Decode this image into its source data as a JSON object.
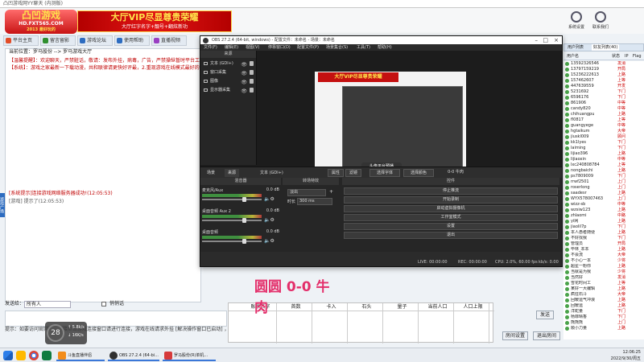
{
  "chat_app": {
    "window_title": "凸凹游戏网YY聊天 (内测版)",
    "logo": {
      "line1": "凸凹游戏",
      "line2": "HD.FXT565.COM",
      "line3": "2013 最好玩的"
    },
    "vip_banner": {
      "title": "大厅VIP尽显尊贵荣耀",
      "subtitle": "大厅红字名字+靓号+翻炫新功"
    },
    "tabs": [
      {
        "label": "平台主页",
        "color": "#e34c26"
      },
      {
        "label": "留言留影",
        "color": "#2f8f2f"
      },
      {
        "label": "游戏论坛",
        "color": "#2d6cc0"
      },
      {
        "label": "使用帮助",
        "color": "#2d6cc0"
      },
      {
        "label": "直播视频",
        "color": "#9a3fc2"
      }
    ],
    "breadcrumb": "当前位置：罗马股份 --> 罗马游戏大厅",
    "messages": [
      {
        "text": "【温馨提醒】：欢迎聊天，严禁脏话，敬请：发布外挂，病毒，广告，严禁操纵暂时平台工作人员",
        "color": "#c00000"
      },
      {
        "text": "【系统】：游戏之家最新一下载动漫，共和联律请更快好评最，2.重现游戏在线模式最好的进行游戏，回顾游戏",
        "color": "#c00000"
      },
      {
        "text": "[系统提示]连接游戏网络服务器成功!(12:05:53)",
        "color": "#c00000"
      },
      {
        "text": "[游戏] 提示了(12:05:53)",
        "color": "#555555"
      }
    ],
    "side_tag": "游戏广场",
    "send_label": "发送给：",
    "send_target": "所有人",
    "private_label": "悄悄话",
    "bottom_hint": "提示：如要访问官网，请直接点击游戏连接窗口请进行连接，游戏在线请求外挂 [解决操作窗口已启动]  ，这个文件",
    "tools": [
      {
        "label": "系统设置"
      },
      {
        "label": "联系我们"
      }
    ],
    "user_panel_tabs": [
      "用户列表",
      "好友列表(40)"
    ],
    "user_columns": [
      "用户名",
      "状态",
      "IP",
      "Flag"
    ],
    "users": [
      {
        "name": "13592326546",
        "status": "发消"
      },
      {
        "name": "13797159219",
        "status": "开局"
      },
      {
        "name": "15236222613",
        "status": "上路"
      },
      {
        "name": "157462607",
        "status": "上等"
      },
      {
        "name": "447639559",
        "status": "开发"
      },
      {
        "name": "5231692",
        "status": "下门"
      },
      {
        "name": "6596176",
        "status": "下门"
      },
      {
        "name": "861906",
        "status": "中等"
      },
      {
        "name": "candy820",
        "status": "中等"
      },
      {
        "name": "chihuangpu",
        "status": "上路"
      },
      {
        "name": "fl0817",
        "status": "上等"
      },
      {
        "name": "guangyege",
        "status": "中等"
      },
      {
        "name": "hgtaikum",
        "status": "大帝"
      },
      {
        "name": "jiuskl009",
        "status": "顾问"
      },
      {
        "name": "kk1lyes",
        "status": "下门"
      },
      {
        "name": "laiming",
        "status": "下门"
      },
      {
        "name": "lijiao396",
        "status": "上路"
      },
      {
        "name": "lijiaoxin",
        "status": "中等"
      },
      {
        "name": "lxc240808784",
        "status": "上等"
      },
      {
        "name": "nongbaichi",
        "status": "上路"
      },
      {
        "name": "ps7809009",
        "status": "下门"
      },
      {
        "name": "rrwf2501",
        "status": "上门"
      },
      {
        "name": "roserlong",
        "status": "上门"
      },
      {
        "name": "saadesr",
        "status": "上路"
      },
      {
        "name": "WYX578007463",
        "status": "上门"
      },
      {
        "name": "wizz-sb",
        "status": "中等"
      },
      {
        "name": "wzsiw123",
        "status": "上路"
      },
      {
        "name": "zhlaomi",
        "status": "中路"
      },
      {
        "name": "yi网",
        "status": "上路"
      },
      {
        "name": "jiaolil7p",
        "status": "下门"
      },
      {
        "name": "本人愚者随便",
        "status": "上路"
      },
      {
        "name": "不好找我",
        "status": "下门"
      },
      {
        "name": "管理员",
        "status": "开局"
      },
      {
        "name": "毕林_本本",
        "status": "上路"
      },
      {
        "name": "不会流",
        "status": "大帝"
      },
      {
        "name": "不小心一本",
        "status": "少将"
      },
      {
        "name": "超星一粉你",
        "status": "上路"
      },
      {
        "name": "当就是为我",
        "status": "少将"
      },
      {
        "name": "当然好",
        "status": "发消"
      },
      {
        "name": "雪花时间工",
        "status": "上等"
      },
      {
        "name": "某好一大编辑",
        "status": "上路"
      },
      {
        "name": "疯狂石斗",
        "status": "大帝"
      },
      {
        "name": "回暖运气冲浪",
        "status": "上路"
      },
      {
        "name": "回暖运",
        "status": "上路"
      },
      {
        "name": "洋蛇量",
        "status": "下门"
      },
      {
        "name": "杨菲晴香",
        "status": "下门"
      },
      {
        "name": "熊熊熊",
        "status": "上门"
      },
      {
        "name": "顺小力量",
        "status": "上路"
      }
    ],
    "right_buttons": {
      "send": "发送",
      "room_settings": "房间设置",
      "refresh": "刷新",
      "exit": "退出房间"
    },
    "sheet_headers": [
      "账家名字",
      "首数",
      "卡入",
      "石头",
      "量子",
      "当前人口",
      "人口上限"
    ]
  },
  "obs": {
    "title": "OBS 27.2.4 (64-bit, windows) - 配置文件：未命名 - 场景：未命名",
    "menu": [
      "文件(F)",
      "编辑(E)",
      "视图(V)",
      "停靠窗口(D)",
      "配置文件(P)",
      "场景集合(S)",
      "工具(T)",
      "帮助(H)"
    ],
    "preview_banner": "大厅VIP尽显尊贵荣耀",
    "preview_chip": "头像平台预播",
    "sources_header": "来源",
    "sources": [
      {
        "label": "文本 (GDI+)"
      },
      {
        "label": "窗口采集"
      },
      {
        "label": "图像"
      },
      {
        "label": "显示器采集"
      }
    ],
    "ctx_tabs": [
      "场景",
      "来源"
    ],
    "ctx_text_label": "文本 (GDI+)",
    "ctx_props": "属性",
    "ctx_filters": "滤镜",
    "ctx_buttons": [
      "选择字体",
      "选择颜色"
    ],
    "ctx_readout": "0-0 牛肉",
    "mixer_header": "混音器",
    "tracks": [
      {
        "name": "麦克风/Aux",
        "db": "0.0 dB",
        "level": 0.72
      },
      {
        "name": "桌面音频 Aux 2",
        "db": "0.0 dB",
        "level": 0.72
      },
      {
        "name": "桌面音频",
        "db": "0.0 dB",
        "level": 0.72
      }
    ],
    "transitions_header": "转场特效",
    "transition_type": "淡出",
    "duration_label": "时长",
    "duration_value": "300 ms",
    "controls_header": "控件",
    "controls": [
      "停止推流",
      "开始录制",
      "启动虚拟摄像机",
      "工作室模式",
      "设置",
      "退出"
    ],
    "status": {
      "live": "LIVE: 00:00:00",
      "rec": "REC: 00:00:00",
      "cpu": "CPU: 2.0%, 60.00 fps",
      "kbps": "kb/s: 0.00"
    }
  },
  "overlay_text": "圆圆 0-0 牛肉",
  "sys_overlay": {
    "value": "28",
    "line1": "↑ 5.8k/s",
    "line2": "↓ 16K/s"
  },
  "taskbar": {
    "apps": [
      {
        "label": "斗鱼直播伴侣",
        "color": "#f28c1b"
      },
      {
        "label": "OBS 27.2.4 (64-bi...",
        "color": "#303030"
      },
      {
        "label": "罗马股份(R)单机...",
        "color": "#d63a3a"
      }
    ],
    "time": "12:06:25",
    "date": "2022/9/30/周五"
  }
}
